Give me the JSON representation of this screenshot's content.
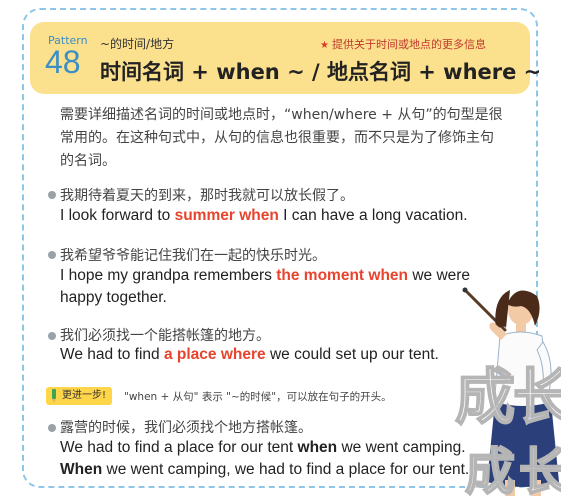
{
  "header": {
    "pattern_label": "Pattern",
    "pattern_number": "48",
    "subtitle": "~的时间/地方",
    "title": "时间名词 + when ~ / 地点名词 + where ~",
    "tip": "提供关于时间或地点的更多信息"
  },
  "intro": "需要详细描述名词的时间或地点时，“when/where + 从句”的句型是很常用的。在这种句式中，从句的信息也很重要，而不只是为了修饰主句的名词。",
  "examples": [
    {
      "cn": "我期待着夏天的到来，那时我就可以放长假了。",
      "en_before": "I look forward to ",
      "en_highlight": "summer when",
      "en_after": " I can have a long vacation."
    },
    {
      "cn": "我希望爷爷能记住我们在一起的快乐时光。",
      "en_before": "I hope my grandpa remembers ",
      "en_highlight": "the moment when",
      "en_after": " we were happy together."
    },
    {
      "cn": "我们必须找一个能搭帐篷的地方。",
      "en_before": "We had to find ",
      "en_highlight": "a place where",
      "en_after": " we could set up our tent."
    }
  ],
  "advance": {
    "badge": "更进一步!",
    "text": "\"when + 从句\" 表示 \"~的时候\"，可以放在句子的开头。"
  },
  "extra_example": {
    "cn": "露营的时候，我们必须找个地方搭帐篷。",
    "en1_before": "We had to find a place for our tent ",
    "en1_bold": "when",
    "en1_after": " we went camping.",
    "en2_bold": "When",
    "en2_after": " we went camping, we had to find a place for our tent."
  },
  "watermark": "成长"
}
